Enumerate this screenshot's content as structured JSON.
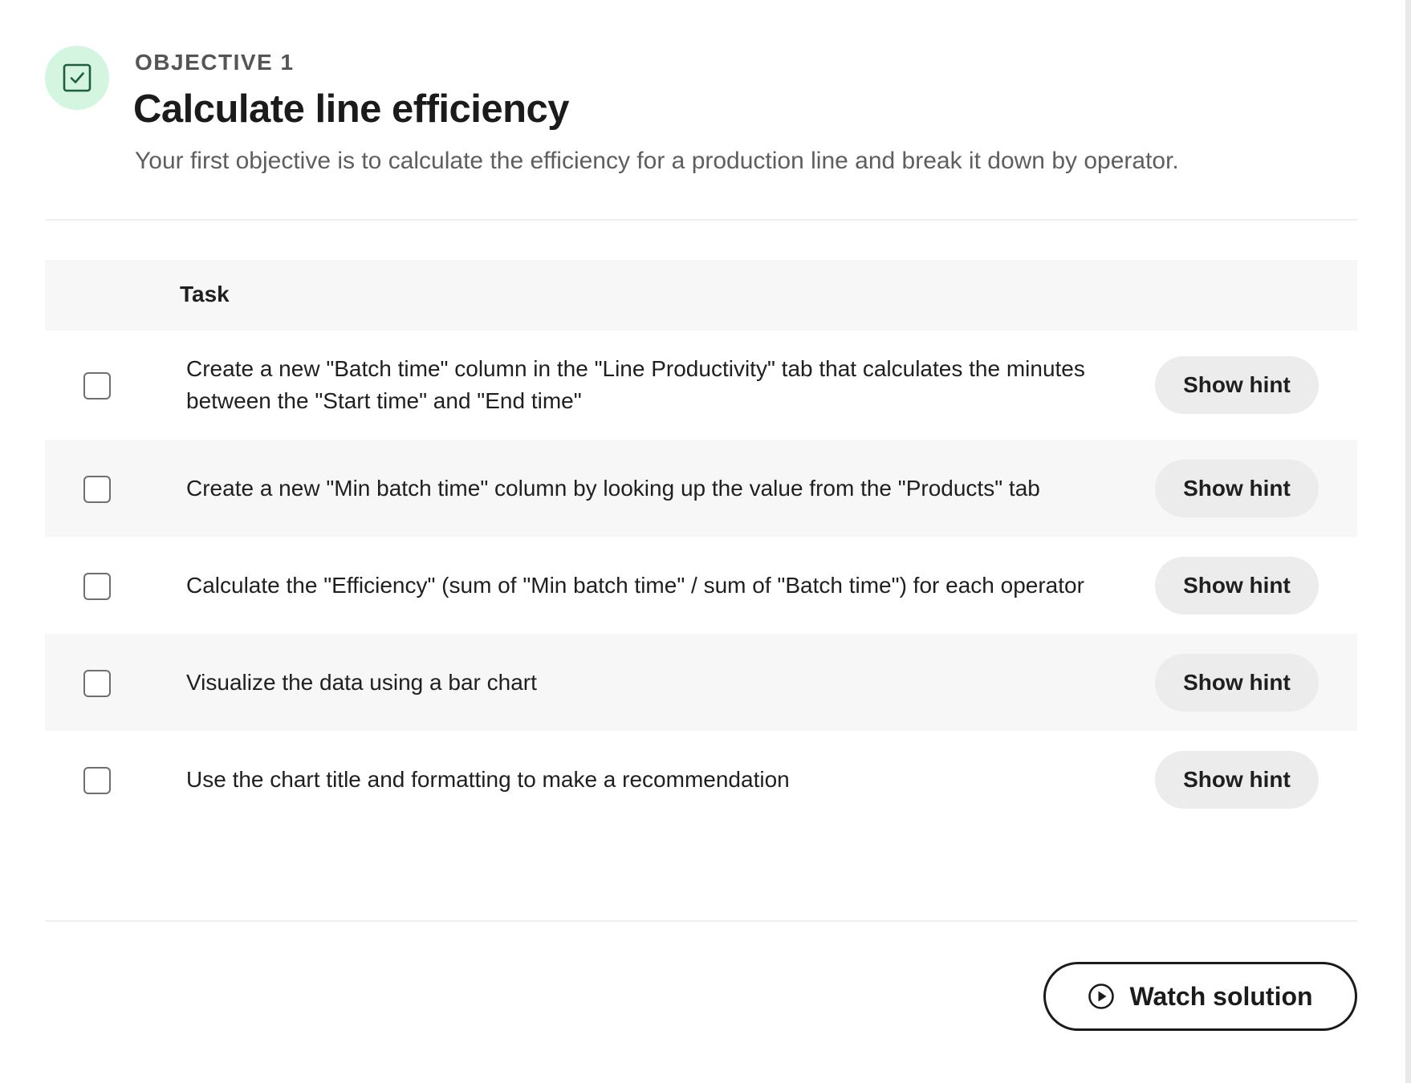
{
  "objective": {
    "kicker": "OBJECTIVE 1",
    "title": "Calculate line efficiency",
    "description": "Your first objective is to calculate the efficiency for a production line and break it down by operator.",
    "badge_icon": "checkbox-checked-icon",
    "badge_color": "#d4f5df",
    "icon_color": "#1f5e3a"
  },
  "table": {
    "column_task": "Task",
    "hint_label": "Show hint",
    "tasks": [
      {
        "text": "Create a new \"Batch time\" column in the \"Line Productivity\" tab that calculates the minutes between the \"Start time\" and \"End time\"",
        "checked": false
      },
      {
        "text": "Create a new \"Min batch time\" column by looking up the value from the \"Products\" tab",
        "checked": false
      },
      {
        "text": "Calculate the \"Efficiency\" (sum of \"Min batch time\" / sum of \"Batch time\") for each operator",
        "checked": false
      },
      {
        "text": "Visualize the data using a bar chart",
        "checked": false
      },
      {
        "text": "Use the chart title and formatting to make a recommendation",
        "checked": false
      }
    ]
  },
  "footer": {
    "watch_label": "Watch solution",
    "watch_icon": "play-circle-icon"
  }
}
